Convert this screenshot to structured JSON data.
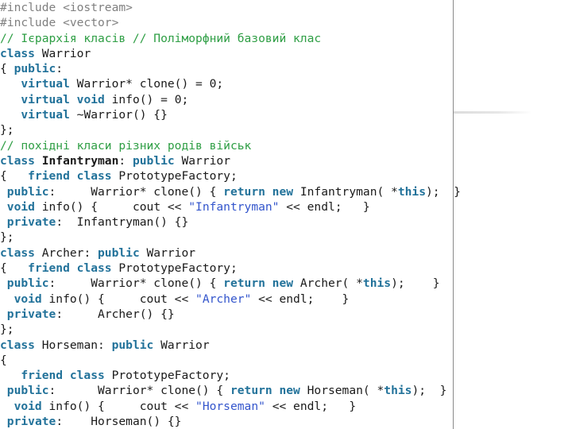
{
  "slide": {
    "background_color": "#ffffff",
    "divider_color": "#8a8a8a",
    "rule_color": "#e0e0e0"
  },
  "theme": {
    "preprocessor_color": "#808080",
    "comment_color": "#2e9e44",
    "keyword_color": "#22729a",
    "string_color": "#3355cc",
    "identifier_color": "#1a1a1a"
  },
  "code": {
    "language": "C++",
    "lines": [
      {
        "id": "l1",
        "tokens": [
          {
            "t": "pre",
            "v": "#include <iostream>"
          }
        ]
      },
      {
        "id": "l2",
        "tokens": [
          {
            "t": "pre",
            "v": "#include <vector>"
          }
        ]
      },
      {
        "id": "l3",
        "tokens": [
          {
            "t": "cmt",
            "v": "// Ієрархія класів // Поліморфний базовий клас"
          }
        ]
      },
      {
        "id": "l4",
        "tokens": [
          {
            "t": "kw",
            "v": "class"
          },
          {
            "t": "id",
            "v": " Warrior"
          }
        ]
      },
      {
        "id": "l5",
        "tokens": [
          {
            "t": "id",
            "v": "{ "
          },
          {
            "t": "kw",
            "v": "public"
          },
          {
            "t": "id",
            "v": ":"
          }
        ]
      },
      {
        "id": "l6",
        "tokens": [
          {
            "t": "id",
            "v": "   "
          },
          {
            "t": "kw",
            "v": "virtual"
          },
          {
            "t": "id",
            "v": " Warrior* clone() = 0;"
          }
        ]
      },
      {
        "id": "l7",
        "tokens": [
          {
            "t": "id",
            "v": "   "
          },
          {
            "t": "kw",
            "v": "virtual"
          },
          {
            "t": "id",
            "v": " "
          },
          {
            "t": "kw",
            "v": "void"
          },
          {
            "t": "id",
            "v": " info() = 0;"
          }
        ]
      },
      {
        "id": "l8",
        "tokens": [
          {
            "t": "id",
            "v": "   "
          },
          {
            "t": "kw",
            "v": "virtual"
          },
          {
            "t": "id",
            "v": " ~Warrior() {}"
          }
        ]
      },
      {
        "id": "l9",
        "tokens": [
          {
            "t": "id",
            "v": "};"
          }
        ]
      },
      {
        "id": "l10",
        "tokens": [
          {
            "t": "cmt",
            "v": "// похідні класи різних родів військ"
          }
        ]
      },
      {
        "id": "l11",
        "tokens": [
          {
            "t": "kw",
            "v": "class"
          },
          {
            "t": "id",
            "v": " "
          },
          {
            "t": "idb",
            "v": "Infantryman"
          },
          {
            "t": "id",
            "v": ": "
          },
          {
            "t": "kw",
            "v": "public"
          },
          {
            "t": "id",
            "v": " Warrior"
          }
        ]
      },
      {
        "id": "l12",
        "tokens": [
          {
            "t": "id",
            "v": "{   "
          },
          {
            "t": "kw",
            "v": "friend class"
          },
          {
            "t": "id",
            "v": " PrototypeFactory;"
          }
        ]
      },
      {
        "id": "l13",
        "tokens": [
          {
            "t": "id",
            "v": " "
          },
          {
            "t": "kw",
            "v": "public"
          },
          {
            "t": "id",
            "v": ":     Warrior* clone() { "
          },
          {
            "t": "kw",
            "v": "return new"
          },
          {
            "t": "id",
            "v": " Infantryman( *"
          },
          {
            "t": "kw",
            "v": "this"
          },
          {
            "t": "id",
            "v": ");  }"
          }
        ]
      },
      {
        "id": "l14",
        "tokens": [
          {
            "t": "id",
            "v": " "
          },
          {
            "t": "kw",
            "v": "void"
          },
          {
            "t": "id",
            "v": " info() {     cout << "
          },
          {
            "t": "str",
            "v": "\"Infantryman\""
          },
          {
            "t": "id",
            "v": " << endl;   }"
          }
        ]
      },
      {
        "id": "l15",
        "tokens": [
          {
            "t": "id",
            "v": " "
          },
          {
            "t": "kw",
            "v": "private"
          },
          {
            "t": "id",
            "v": ":  Infantryman() {}"
          }
        ]
      },
      {
        "id": "l16",
        "tokens": [
          {
            "t": "id",
            "v": "};"
          }
        ]
      },
      {
        "id": "l17",
        "tokens": [
          {
            "t": "kw",
            "v": "class"
          },
          {
            "t": "id",
            "v": " Archer: "
          },
          {
            "t": "kw",
            "v": "public"
          },
          {
            "t": "id",
            "v": " Warrior"
          }
        ]
      },
      {
        "id": "l18",
        "tokens": [
          {
            "t": "id",
            "v": "{   "
          },
          {
            "t": "kw",
            "v": "friend class"
          },
          {
            "t": "id",
            "v": " PrototypeFactory;"
          }
        ]
      },
      {
        "id": "l19",
        "tokens": [
          {
            "t": "id",
            "v": " "
          },
          {
            "t": "kw",
            "v": "public"
          },
          {
            "t": "id",
            "v": ":     Warrior* clone() { "
          },
          {
            "t": "kw",
            "v": "return new"
          },
          {
            "t": "id",
            "v": " Archer( *"
          },
          {
            "t": "kw",
            "v": "this"
          },
          {
            "t": "id",
            "v": ");    }"
          }
        ]
      },
      {
        "id": "l20",
        "tokens": [
          {
            "t": "id",
            "v": "  "
          },
          {
            "t": "kw",
            "v": "void"
          },
          {
            "t": "id",
            "v": " info() {     cout << "
          },
          {
            "t": "str",
            "v": "\"Archer\""
          },
          {
            "t": "id",
            "v": " << endl;    }"
          }
        ]
      },
      {
        "id": "l21",
        "tokens": [
          {
            "t": "id",
            "v": " "
          },
          {
            "t": "kw",
            "v": "private"
          },
          {
            "t": "id",
            "v": ":     Archer() {}"
          }
        ]
      },
      {
        "id": "l22",
        "tokens": [
          {
            "t": "id",
            "v": "};"
          }
        ]
      },
      {
        "id": "l23",
        "tokens": [
          {
            "t": "kw",
            "v": "class"
          },
          {
            "t": "id",
            "v": " Horseman: "
          },
          {
            "t": "kw",
            "v": "public"
          },
          {
            "t": "id",
            "v": " Warrior"
          }
        ]
      },
      {
        "id": "l24",
        "tokens": [
          {
            "t": "id",
            "v": "{"
          }
        ]
      },
      {
        "id": "l25",
        "tokens": [
          {
            "t": "id",
            "v": "   "
          },
          {
            "t": "kw",
            "v": "friend class"
          },
          {
            "t": "id",
            "v": " PrototypeFactory;"
          }
        ]
      },
      {
        "id": "l26",
        "tokens": [
          {
            "t": "id",
            "v": " "
          },
          {
            "t": "kw",
            "v": "public"
          },
          {
            "t": "id",
            "v": ":      Warrior* clone() { "
          },
          {
            "t": "kw",
            "v": "return new"
          },
          {
            "t": "id",
            "v": " Horseman( *"
          },
          {
            "t": "kw",
            "v": "this"
          },
          {
            "t": "id",
            "v": ");  }"
          }
        ]
      },
      {
        "id": "l27",
        "tokens": [
          {
            "t": "id",
            "v": "  "
          },
          {
            "t": "kw",
            "v": "void"
          },
          {
            "t": "id",
            "v": " info() {     cout << "
          },
          {
            "t": "str",
            "v": "\"Horseman\""
          },
          {
            "t": "id",
            "v": " << endl;   }"
          }
        ]
      },
      {
        "id": "l28",
        "tokens": [
          {
            "t": "id",
            "v": " "
          },
          {
            "t": "kw",
            "v": "private"
          },
          {
            "t": "id",
            "v": ":    Horseman() {}"
          }
        ]
      }
    ]
  }
}
